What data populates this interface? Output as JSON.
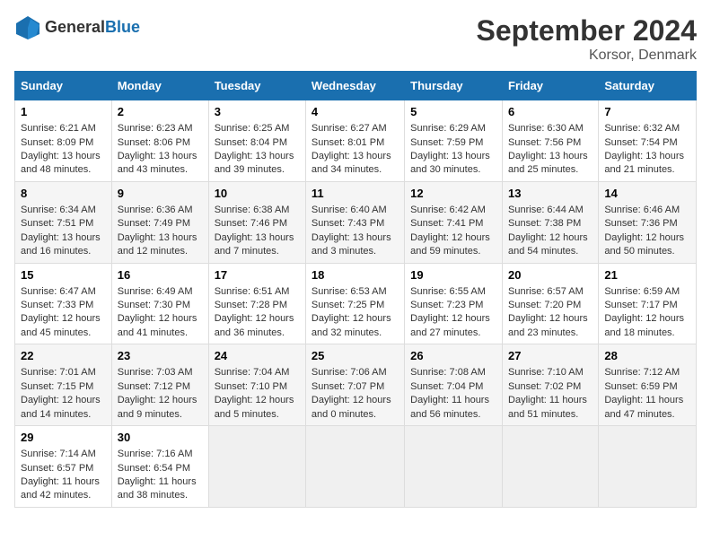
{
  "header": {
    "logo_general": "General",
    "logo_blue": "Blue",
    "title": "September 2024",
    "subtitle": "Korsor, Denmark"
  },
  "days_of_week": [
    "Sunday",
    "Monday",
    "Tuesday",
    "Wednesday",
    "Thursday",
    "Friday",
    "Saturday"
  ],
  "weeks": [
    [
      {
        "day": 1,
        "sunrise": "6:21 AM",
        "sunset": "8:09 PM",
        "daylight": "13 hours and 48 minutes."
      },
      {
        "day": 2,
        "sunrise": "6:23 AM",
        "sunset": "8:06 PM",
        "daylight": "13 hours and 43 minutes."
      },
      {
        "day": 3,
        "sunrise": "6:25 AM",
        "sunset": "8:04 PM",
        "daylight": "13 hours and 39 minutes."
      },
      {
        "day": 4,
        "sunrise": "6:27 AM",
        "sunset": "8:01 PM",
        "daylight": "13 hours and 34 minutes."
      },
      {
        "day": 5,
        "sunrise": "6:29 AM",
        "sunset": "7:59 PM",
        "daylight": "13 hours and 30 minutes."
      },
      {
        "day": 6,
        "sunrise": "6:30 AM",
        "sunset": "7:56 PM",
        "daylight": "13 hours and 25 minutes."
      },
      {
        "day": 7,
        "sunrise": "6:32 AM",
        "sunset": "7:54 PM",
        "daylight": "13 hours and 21 minutes."
      }
    ],
    [
      {
        "day": 8,
        "sunrise": "6:34 AM",
        "sunset": "7:51 PM",
        "daylight": "13 hours and 16 minutes."
      },
      {
        "day": 9,
        "sunrise": "6:36 AM",
        "sunset": "7:49 PM",
        "daylight": "13 hours and 12 minutes."
      },
      {
        "day": 10,
        "sunrise": "6:38 AM",
        "sunset": "7:46 PM",
        "daylight": "13 hours and 7 minutes."
      },
      {
        "day": 11,
        "sunrise": "6:40 AM",
        "sunset": "7:43 PM",
        "daylight": "13 hours and 3 minutes."
      },
      {
        "day": 12,
        "sunrise": "6:42 AM",
        "sunset": "7:41 PM",
        "daylight": "12 hours and 59 minutes."
      },
      {
        "day": 13,
        "sunrise": "6:44 AM",
        "sunset": "7:38 PM",
        "daylight": "12 hours and 54 minutes."
      },
      {
        "day": 14,
        "sunrise": "6:46 AM",
        "sunset": "7:36 PM",
        "daylight": "12 hours and 50 minutes."
      }
    ],
    [
      {
        "day": 15,
        "sunrise": "6:47 AM",
        "sunset": "7:33 PM",
        "daylight": "12 hours and 45 minutes."
      },
      {
        "day": 16,
        "sunrise": "6:49 AM",
        "sunset": "7:30 PM",
        "daylight": "12 hours and 41 minutes."
      },
      {
        "day": 17,
        "sunrise": "6:51 AM",
        "sunset": "7:28 PM",
        "daylight": "12 hours and 36 minutes."
      },
      {
        "day": 18,
        "sunrise": "6:53 AM",
        "sunset": "7:25 PM",
        "daylight": "12 hours and 32 minutes."
      },
      {
        "day": 19,
        "sunrise": "6:55 AM",
        "sunset": "7:23 PM",
        "daylight": "12 hours and 27 minutes."
      },
      {
        "day": 20,
        "sunrise": "6:57 AM",
        "sunset": "7:20 PM",
        "daylight": "12 hours and 23 minutes."
      },
      {
        "day": 21,
        "sunrise": "6:59 AM",
        "sunset": "7:17 PM",
        "daylight": "12 hours and 18 minutes."
      }
    ],
    [
      {
        "day": 22,
        "sunrise": "7:01 AM",
        "sunset": "7:15 PM",
        "daylight": "12 hours and 14 minutes."
      },
      {
        "day": 23,
        "sunrise": "7:03 AM",
        "sunset": "7:12 PM",
        "daylight": "12 hours and 9 minutes."
      },
      {
        "day": 24,
        "sunrise": "7:04 AM",
        "sunset": "7:10 PM",
        "daylight": "12 hours and 5 minutes."
      },
      {
        "day": 25,
        "sunrise": "7:06 AM",
        "sunset": "7:07 PM",
        "daylight": "12 hours and 0 minutes."
      },
      {
        "day": 26,
        "sunrise": "7:08 AM",
        "sunset": "7:04 PM",
        "daylight": "11 hours and 56 minutes."
      },
      {
        "day": 27,
        "sunrise": "7:10 AM",
        "sunset": "7:02 PM",
        "daylight": "11 hours and 51 minutes."
      },
      {
        "day": 28,
        "sunrise": "7:12 AM",
        "sunset": "6:59 PM",
        "daylight": "11 hours and 47 minutes."
      }
    ],
    [
      {
        "day": 29,
        "sunrise": "7:14 AM",
        "sunset": "6:57 PM",
        "daylight": "11 hours and 42 minutes."
      },
      {
        "day": 30,
        "sunrise": "7:16 AM",
        "sunset": "6:54 PM",
        "daylight": "11 hours and 38 minutes."
      },
      null,
      null,
      null,
      null,
      null
    ]
  ]
}
